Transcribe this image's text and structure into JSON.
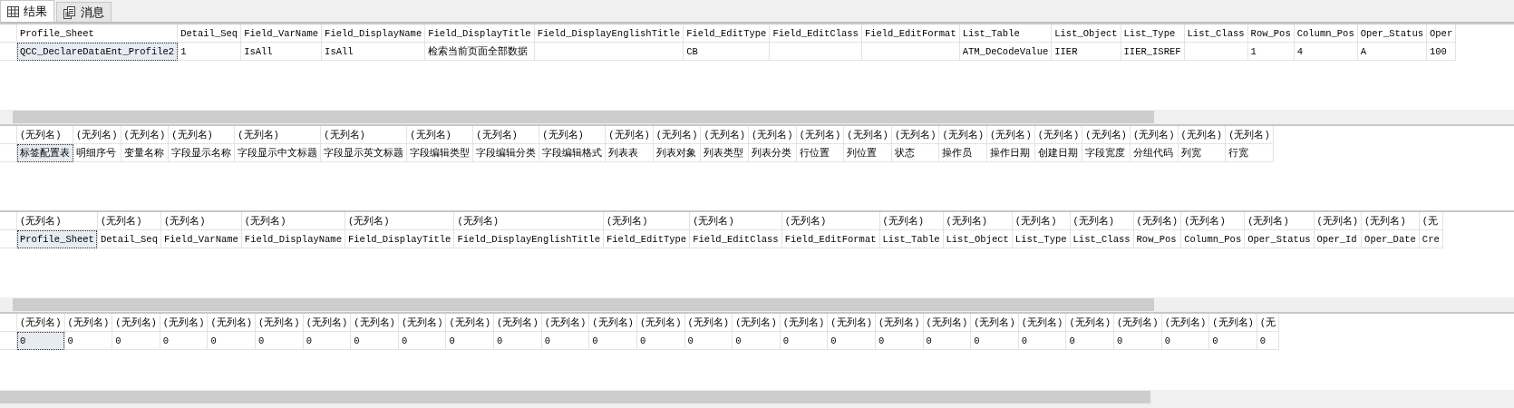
{
  "tabs": [
    {
      "label": "结果",
      "selected": true,
      "kind": "grid"
    },
    {
      "label": "消息",
      "selected": false,
      "kind": "messages"
    }
  ],
  "grids": [
    {
      "scrollbar": true,
      "columns": [
        "Profile_Sheet",
        "Detail_Seq",
        "Field_VarName",
        "Field_DisplayName",
        "Field_DisplayTitle",
        "Field_DisplayEnglishTitle",
        "Field_EditType",
        "Field_EditClass",
        "Field_EditFormat",
        "List_Table",
        "List_Object",
        "List_Type",
        "List_Class",
        "Row_Pos",
        "Column_Pos",
        "Oper_Status",
        "Oper"
      ],
      "rows": [
        [
          {
            "text": "QCC_DeclareDataEnt_Profile2",
            "selected": true
          },
          {
            "text": "1",
            "selected": false
          },
          {
            "text": "IsAll",
            "selected": false
          },
          {
            "text": "IsAll",
            "selected": false
          },
          {
            "text": "检索当前页面全部数据",
            "selected": false
          },
          {
            "selected": false
          },
          {
            "text": "CB",
            "selected": false
          },
          {
            "selected": false
          },
          {
            "selected": false
          },
          {
            "text": "ATM_DeCodeValue",
            "selected": false
          },
          {
            "text": "IIER",
            "selected": false
          },
          {
            "text": "IIER_ISREF",
            "selected": false
          },
          {
            "selected": false
          },
          {
            "text": "1",
            "selected": false
          },
          {
            "text": "4",
            "selected": false
          },
          {
            "text": "A",
            "selected": false
          },
          {
            "text": "100",
            "selected": false
          }
        ]
      ]
    },
    {
      "scrollbar": false,
      "columns": [
        "(无列名)",
        "(无列名)",
        "(无列名)",
        "(无列名)",
        "(无列名)",
        "(无列名)",
        "(无列名)",
        "(无列名)",
        "(无列名)",
        "(无列名)",
        "(无列名)",
        "(无列名)",
        "(无列名)",
        "(无列名)",
        "(无列名)",
        "(无列名)",
        "(无列名)",
        "(无列名)",
        "(无列名)",
        "(无列名)",
        "(无列名)",
        "(无列名)",
        "(无列名)"
      ],
      "rows": [
        [
          {
            "text": "标签配置表",
            "selected": true
          },
          {
            "text": "明细序号",
            "selected": false
          },
          {
            "text": "变量名称",
            "selected": false
          },
          {
            "text": "字段显示名称",
            "selected": false
          },
          {
            "text": "字段显示中文标题",
            "selected": false
          },
          {
            "text": "字段显示英文标题",
            "selected": false
          },
          {
            "text": "字段编辑类型",
            "selected": false
          },
          {
            "text": "字段编辑分类",
            "selected": false
          },
          {
            "text": "字段编辑格式",
            "selected": false
          },
          {
            "text": "列表表",
            "selected": false
          },
          {
            "text": "列表对象",
            "selected": false
          },
          {
            "text": "列表类型",
            "selected": false
          },
          {
            "text": "列表分类",
            "selected": false
          },
          {
            "text": "行位置",
            "selected": false
          },
          {
            "text": "列位置",
            "selected": false
          },
          {
            "text": "状态",
            "selected": false
          },
          {
            "text": "操作员",
            "selected": false
          },
          {
            "text": "操作日期",
            "selected": false
          },
          {
            "text": "创建日期",
            "selected": false
          },
          {
            "text": "字段宽度",
            "selected": false
          },
          {
            "text": "分组代码",
            "selected": false
          },
          {
            "text": "列宽",
            "selected": false
          },
          {
            "text": "行宽",
            "selected": false
          }
        ]
      ]
    },
    {
      "scrollbar": true,
      "columns": [
        "(无列名)",
        "(无列名)",
        "(无列名)",
        "(无列名)",
        "(无列名)",
        "(无列名)",
        "(无列名)",
        "(无列名)",
        "(无列名)",
        "(无列名)",
        "(无列名)",
        "(无列名)",
        "(无列名)",
        "(无列名)",
        "(无列名)",
        "(无列名)",
        "(无列名)",
        "(无列名)",
        "(无"
      ],
      "rows": [
        [
          {
            "text": "Profile_Sheet",
            "selected": true
          },
          {
            "text": "Detail_Seq",
            "selected": false
          },
          {
            "text": "Field_VarName",
            "selected": false
          },
          {
            "text": "Field_DisplayName",
            "selected": false
          },
          {
            "text": "Field_DisplayTitle",
            "selected": false
          },
          {
            "text": "Field_DisplayEnglishTitle",
            "selected": false
          },
          {
            "text": "Field_EditType",
            "selected": false
          },
          {
            "text": "Field_EditClass",
            "selected": false
          },
          {
            "text": "Field_EditFormat",
            "selected": false
          },
          {
            "text": "List_Table",
            "selected": false
          },
          {
            "text": "List_Object",
            "selected": false
          },
          {
            "text": "List_Type",
            "selected": false
          },
          {
            "text": "List_Class",
            "selected": false
          },
          {
            "text": "Row_Pos",
            "selected": false
          },
          {
            "text": "Column_Pos",
            "selected": false
          },
          {
            "text": "Oper_Status",
            "selected": false
          },
          {
            "text": "Oper_Id",
            "selected": false
          },
          {
            "text": "Oper_Date",
            "selected": false
          },
          {
            "text": "Cre",
            "selected": false
          }
        ]
      ]
    },
    {
      "scrollbar": true,
      "columns": [
        "(无列名)",
        "(无列名)",
        "(无列名)",
        "(无列名)",
        "(无列名)",
        "(无列名)",
        "(无列名)",
        "(无列名)",
        "(无列名)",
        "(无列名)",
        "(无列名)",
        "(无列名)",
        "(无列名)",
        "(无列名)",
        "(无列名)",
        "(无列名)",
        "(无列名)",
        "(无列名)",
        "(无列名)",
        "(无列名)",
        "(无列名)",
        "(无列名)",
        "(无列名)",
        "(无列名)",
        "(无列名)",
        "(无列名)",
        "(无"
      ],
      "rows": [
        [
          {
            "text": "0",
            "selected": true
          },
          {
            "text": "0",
            "selected": false
          },
          {
            "text": "0",
            "selected": false
          },
          {
            "text": "0",
            "selected": false
          },
          {
            "text": "0",
            "selected": false
          },
          {
            "text": "0",
            "selected": false
          },
          {
            "text": "0",
            "selected": false
          },
          {
            "text": "0",
            "selected": false
          },
          {
            "text": "0",
            "selected": false
          },
          {
            "text": "0",
            "selected": false
          },
          {
            "text": "0",
            "selected": false
          },
          {
            "text": "0",
            "selected": false
          },
          {
            "text": "0",
            "selected": false
          },
          {
            "text": "0",
            "selected": false
          },
          {
            "text": "0",
            "selected": false
          },
          {
            "text": "0",
            "selected": false
          },
          {
            "text": "0",
            "selected": false
          },
          {
            "text": "0",
            "selected": false
          },
          {
            "text": "0",
            "selected": false
          },
          {
            "text": "0",
            "selected": false
          },
          {
            "text": "0",
            "selected": false
          },
          {
            "text": "0",
            "selected": false
          },
          {
            "text": "0",
            "selected": false
          },
          {
            "text": "0",
            "selected": false
          },
          {
            "text": "0",
            "selected": false
          },
          {
            "text": "0",
            "selected": false
          },
          {
            "text": "0",
            "selected": false
          }
        ]
      ]
    }
  ]
}
